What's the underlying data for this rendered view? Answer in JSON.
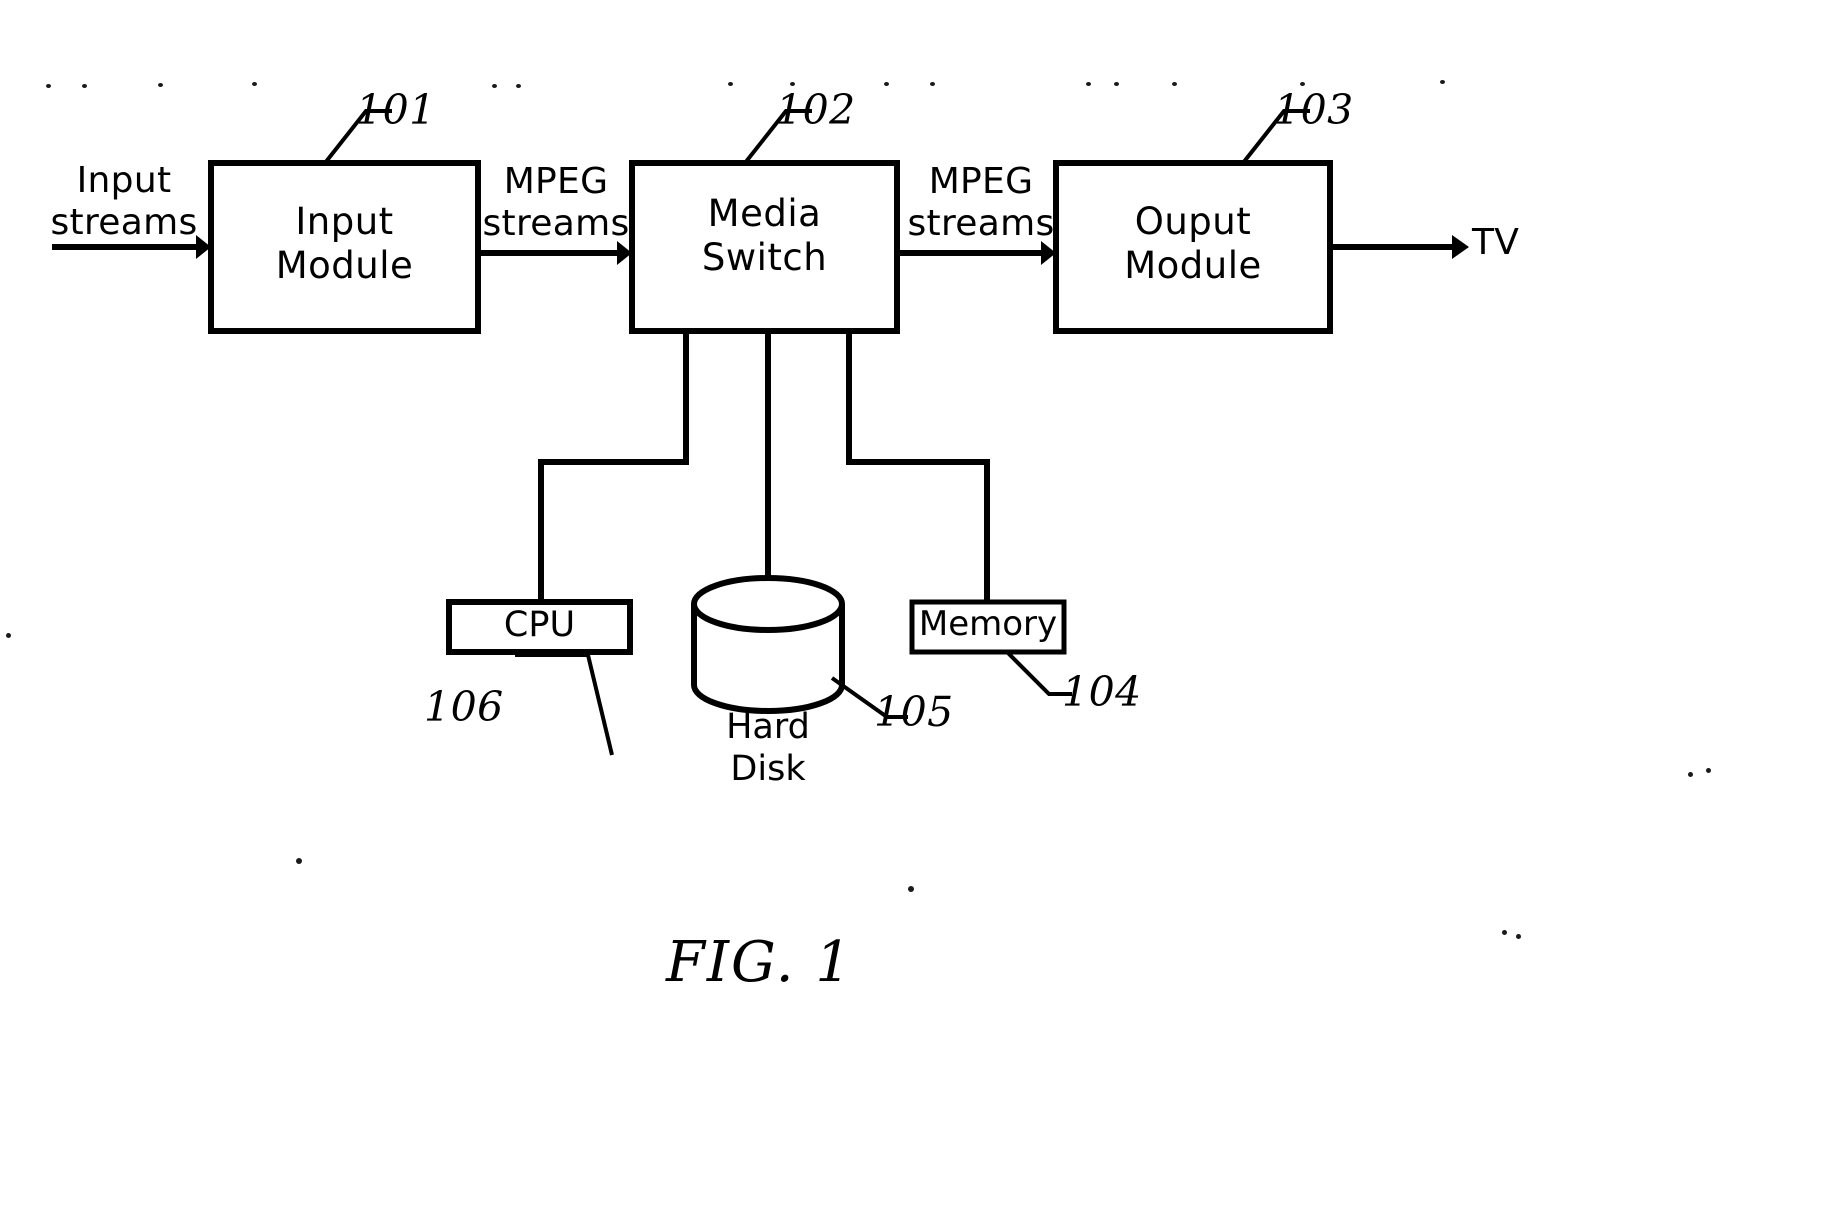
{
  "figure": {
    "caption": "FIG. 1",
    "blocks": [
      {
        "id": "input-module",
        "label": "Input\nModule",
        "ref": "101"
      },
      {
        "id": "media-switch",
        "label": "Media\nSwitch",
        "ref": "102"
      },
      {
        "id": "ouput-module",
        "label": "Ouput\nModule",
        "ref": "103"
      },
      {
        "id": "cpu",
        "label": "CPU",
        "ref": "106"
      },
      {
        "id": "hard-disk",
        "label": "Hard\nDisk",
        "ref": "105"
      },
      {
        "id": "memory",
        "label": "Memory",
        "ref": "104"
      }
    ],
    "edges": [
      {
        "id": "input-streams",
        "label": "Input\nstreams"
      },
      {
        "id": "mpeg-streams-left",
        "label": "MPEG\nstreams"
      },
      {
        "id": "mpeg-streams-right",
        "label": "MPEG\nstreams"
      },
      {
        "id": "tv-output",
        "label": "TV"
      }
    ],
    "colors": {
      "line": "#000000",
      "background": "#ffffff",
      "text": "#000000"
    }
  }
}
